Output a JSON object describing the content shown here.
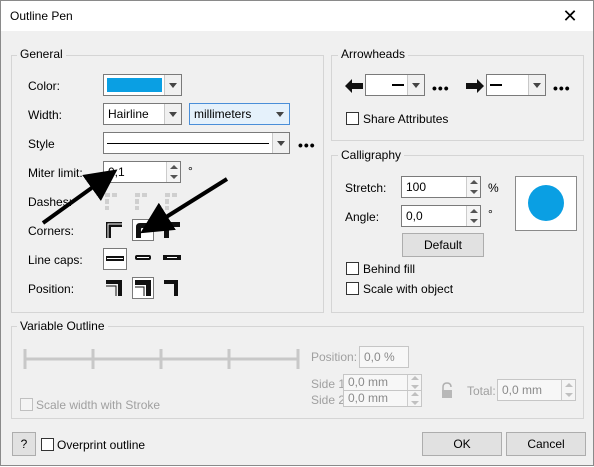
{
  "window": {
    "title": "Outline Pen",
    "close_glyph": "✕"
  },
  "general": {
    "title": "General",
    "color_label": "Color:",
    "color_value": "#0a9fe3",
    "width_label": "Width:",
    "width_value": "Hairline",
    "units_value": "millimeters",
    "style_label": "Style",
    "more_glyph": "•••",
    "miter_label": "Miter limit:",
    "miter_value": "0,1",
    "miter_unit": "°",
    "dashes_label": "Dashes:",
    "corners_label": "Corners:",
    "linecaps_label": "Line caps:",
    "position_label": "Position:"
  },
  "arrowheads": {
    "title": "Arrowheads",
    "share_label": "Share Attributes",
    "share_underline": "S"
  },
  "calligraphy": {
    "title": "Calligraphy",
    "stretch_label": "Stretch:",
    "stretch_value": "100",
    "stretch_unit": "%",
    "angle_label": "Angle:",
    "angle_value": "0,0",
    "angle_unit": "°",
    "default_label": "Default",
    "behind_fill_label": "Behind fill",
    "scale_label": "Scale with object"
  },
  "variable": {
    "title": "Variable Outline",
    "position_label": "Position:",
    "position_value": "0,0 %",
    "side1_label": "Side 1:",
    "side1_value": "0,0 mm",
    "side2_label": "Side 2:",
    "side2_value": "0,0 mm",
    "total_label": "Total:",
    "total_value": "0,0 mm",
    "scale_stroke_label": "Scale width with Stroke"
  },
  "footer": {
    "help_label": "?",
    "overprint_label": "Overprint outline",
    "ok_label": "OK",
    "cancel_label": "Cancel"
  }
}
